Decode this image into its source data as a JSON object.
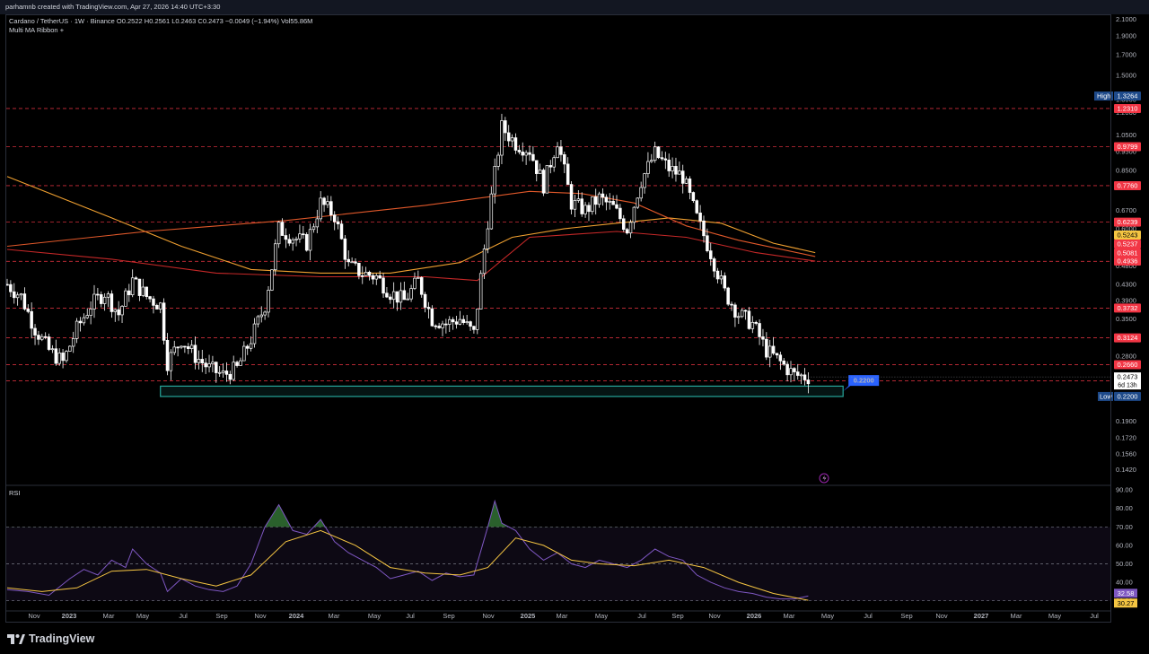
{
  "header": {
    "credit": "parhamnb created with TradingView.com, Apr 27, 2026 14:40 UTC+3:30",
    "symbol_line": "Cardano / TetherUS · 1W · Binance  O0.2522  H0.2561  L0.2463  C0.2473  −0.0049 (−1.94%)  Vol55.86M",
    "indicator": "Multi MA Ribbon +"
  },
  "rsi_panel": {
    "label": "RSI"
  },
  "branding": {
    "name": "TradingView"
  },
  "colors": {
    "background": "#000000",
    "up_candle": "#ffffff",
    "down_candle": "#ffffff",
    "resistance_line": "#f23645",
    "support_zone": "#26a69a",
    "ma_orange": "#f0a030",
    "ma_red": "#c62828",
    "rsi_line": "#7e57c2",
    "rsi_ma": "#f5c542",
    "low_tag": "#1e4a8a",
    "callout": "#2962ff"
  },
  "chart_data": [
    {
      "type": "candlestick",
      "title": "Cardano / TetherUS · 1W · Binance",
      "y_scale": "log",
      "ylim": [
        0.13,
        2.15
      ],
      "price_ticks": [
        "2.1000",
        "1.9000",
        "1.7000",
        "1.5000",
        "1.3000",
        "1.2000",
        "1.0500",
        "0.9500",
        "0.8500",
        "0.7700",
        "0.6700",
        "0.6000",
        "0.5200",
        "0.4800",
        "0.4300",
        "0.3900",
        "0.3500",
        "0.3100",
        "0.2800",
        "0.2500",
        "0.2200",
        "0.1900",
        "0.1720",
        "0.1560",
        "0.1420"
      ],
      "x_ticks": [
        "Nov",
        "2023",
        "Mar",
        "May",
        "Jul",
        "Sep",
        "Nov",
        "2024",
        "Mar",
        "May",
        "Jul",
        "Sep",
        "Nov",
        "2025",
        "Mar",
        "May",
        "Jul",
        "Sep",
        "Nov",
        "2026",
        "Mar",
        "May",
        "Jul",
        "Sep",
        "Nov",
        "2027",
        "Mar",
        "May",
        "Jul"
      ],
      "x_range_weeks": [
        0,
        253
      ],
      "ohlc": {
        "open": "0.2522",
        "high": "0.2561",
        "low": "0.2463",
        "close": "0.2473",
        "change": "−0.0049",
        "change_pct": "−1.94%",
        "volume": "55.86M"
      },
      "period_high": {
        "label": "High",
        "value": "1.3264"
      },
      "period_low": {
        "label": "Low",
        "value": "0.2200"
      },
      "horizontal_levels": [
        1.231,
        0.9799,
        0.776,
        0.6239,
        0.4936,
        0.3732,
        0.3124,
        0.266,
        0.2415
      ],
      "price_tags": [
        {
          "value": "1.2310",
          "color": "#f23645"
        },
        {
          "value": "0.9799",
          "color": "#f23645"
        },
        {
          "value": "0.7760",
          "color": "#f23645"
        },
        {
          "value": "0.6239",
          "color": "#f23645"
        },
        {
          "value": "0.5243",
          "color": "#f5c542"
        },
        {
          "value": "0.5237",
          "color": "#f23645"
        },
        {
          "value": "0.5081",
          "color": "#f23645"
        },
        {
          "value": "0.4936",
          "color": "#f23645"
        },
        {
          "value": "0.3732",
          "color": "#f23645"
        },
        {
          "value": "0.3124",
          "color": "#f23645"
        },
        {
          "value": "0.2660",
          "color": "#f23645"
        },
        {
          "value": "0.2415",
          "color": "#f23645"
        }
      ],
      "last_price": {
        "value": "0.2473",
        "countdown": "6d 13h"
      },
      "support_zone": {
        "from": 0.22,
        "to": 0.234,
        "label": "0.2200"
      },
      "moving_averages": [
        {
          "color": "#f0a030",
          "points": [
            [
              0,
              0.82
            ],
            [
              30,
              0.64
            ],
            [
              50,
              0.54
            ],
            [
              70,
              0.47
            ],
            [
              90,
              0.46
            ],
            [
              110,
              0.46
            ],
            [
              130,
              0.49
            ],
            [
              145,
              0.57
            ],
            [
              160,
              0.6
            ],
            [
              175,
              0.62
            ],
            [
              190,
              0.64
            ],
            [
              205,
              0.62
            ],
            [
              220,
              0.55
            ],
            [
              232,
              0.52
            ]
          ]
        },
        {
          "color": "#e0582a",
          "points": [
            [
              0,
              0.54
            ],
            [
              40,
              0.59
            ],
            [
              80,
              0.63
            ],
            [
              120,
              0.69
            ],
            [
              150,
              0.75
            ],
            [
              165,
              0.74
            ],
            [
              180,
              0.7
            ],
            [
              195,
              0.61
            ],
            [
              210,
              0.56
            ],
            [
              232,
              0.508
            ]
          ]
        },
        {
          "color": "#c62828",
          "points": [
            [
              0,
              0.53
            ],
            [
              30,
              0.5
            ],
            [
              60,
              0.46
            ],
            [
              90,
              0.45
            ],
            [
              120,
              0.45
            ],
            [
              135,
              0.44
            ],
            [
              150,
              0.57
            ],
            [
              175,
              0.59
            ],
            [
              195,
              0.57
            ],
            [
              215,
              0.52
            ],
            [
              232,
              0.494
            ]
          ]
        }
      ],
      "close_path": [
        [
          0,
          0.43
        ],
        [
          4,
          0.4
        ],
        [
          8,
          0.33
        ],
        [
          12,
          0.29
        ],
        [
          16,
          0.27
        ],
        [
          20,
          0.33
        ],
        [
          24,
          0.38
        ],
        [
          28,
          0.41
        ],
        [
          32,
          0.36
        ],
        [
          36,
          0.44
        ],
        [
          40,
          0.4
        ],
        [
          44,
          0.38
        ],
        [
          46,
          0.27
        ],
        [
          50,
          0.31
        ],
        [
          54,
          0.28
        ],
        [
          58,
          0.26
        ],
        [
          62,
          0.25
        ],
        [
          66,
          0.26
        ],
        [
          70,
          0.31
        ],
        [
          74,
          0.38
        ],
        [
          78,
          0.6
        ],
        [
          82,
          0.57
        ],
        [
          86,
          0.55
        ],
        [
          90,
          0.7
        ],
        [
          94,
          0.65
        ],
        [
          98,
          0.48
        ],
        [
          102,
          0.46
        ],
        [
          106,
          0.45
        ],
        [
          110,
          0.41
        ],
        [
          114,
          0.39
        ],
        [
          118,
          0.44
        ],
        [
          122,
          0.35
        ],
        [
          126,
          0.34
        ],
        [
          130,
          0.35
        ],
        [
          134,
          0.32
        ],
        [
          138,
          0.63
        ],
        [
          142,
          1.1
        ],
        [
          146,
          1.0
        ],
        [
          150,
          0.96
        ],
        [
          154,
          0.78
        ],
        [
          158,
          1.02
        ],
        [
          162,
          0.7
        ],
        [
          166,
          0.67
        ],
        [
          170,
          0.72
        ],
        [
          174,
          0.68
        ],
        [
          178,
          0.6
        ],
        [
          182,
          0.8
        ],
        [
          186,
          0.94
        ],
        [
          190,
          0.86
        ],
        [
          194,
          0.82
        ],
        [
          198,
          0.64
        ],
        [
          202,
          0.52
        ],
        [
          206,
          0.41
        ],
        [
          210,
          0.36
        ],
        [
          214,
          0.34
        ],
        [
          218,
          0.29
        ],
        [
          222,
          0.27
        ],
        [
          226,
          0.25
        ],
        [
          230,
          0.2473
        ]
      ]
    },
    {
      "type": "line",
      "title": "RSI",
      "ylim": [
        25,
        92
      ],
      "y_ticks": [
        "90.00",
        "80.00",
        "70.00",
        "60.00",
        "50.00",
        "40.00",
        "30.00"
      ],
      "band": [
        30,
        70
      ],
      "rsi_value": "32.58",
      "rsi_ma_value": "30.27",
      "series": [
        {
          "points": [
            [
              0,
              36
            ],
            [
              6,
              35
            ],
            [
              12,
              33
            ],
            [
              18,
              42
            ],
            [
              22,
              47
            ],
            [
              26,
              44
            ],
            [
              30,
              52
            ],
            [
              34,
              48
            ],
            [
              36,
              58
            ],
            [
              40,
              50
            ],
            [
              44,
              45
            ],
            [
              46,
              35
            ],
            [
              50,
              42
            ],
            [
              54,
              38
            ],
            [
              58,
              36
            ],
            [
              62,
              35
            ],
            [
              66,
              38
            ],
            [
              70,
              50
            ],
            [
              74,
              70
            ],
            [
              78,
              82
            ],
            [
              82,
              68
            ],
            [
              86,
              66
            ],
            [
              90,
              74
            ],
            [
              94,
              62
            ],
            [
              98,
              56
            ],
            [
              102,
              52
            ],
            [
              106,
              48
            ],
            [
              110,
              42
            ],
            [
              114,
              44
            ],
            [
              118,
              46
            ],
            [
              122,
              41
            ],
            [
              126,
              45
            ],
            [
              130,
              43
            ],
            [
              134,
              44
            ],
            [
              138,
              70
            ],
            [
              140,
              84
            ],
            [
              142,
              72
            ],
            [
              146,
              68
            ],
            [
              150,
              58
            ],
            [
              154,
              52
            ],
            [
              158,
              56
            ],
            [
              162,
              50
            ],
            [
              166,
              48
            ],
            [
              170,
              52
            ],
            [
              174,
              50
            ],
            [
              178,
              48
            ],
            [
              182,
              52
            ],
            [
              186,
              58
            ],
            [
              190,
              54
            ],
            [
              194,
              52
            ],
            [
              198,
              44
            ],
            [
              202,
              40
            ],
            [
              206,
              37
            ],
            [
              210,
              35
            ],
            [
              214,
              34
            ],
            [
              218,
              32
            ],
            [
              222,
              31
            ],
            [
              226,
              31
            ],
            [
              230,
              32.58
            ]
          ]
        },
        {
          "points": [
            [
              0,
              37
            ],
            [
              10,
              35
            ],
            [
              20,
              37
            ],
            [
              30,
              46
            ],
            [
              40,
              47
            ],
            [
              50,
              42
            ],
            [
              60,
              38
            ],
            [
              70,
              44
            ],
            [
              80,
              62
            ],
            [
              90,
              68
            ],
            [
              100,
              60
            ],
            [
              110,
              48
            ],
            [
              120,
              45
            ],
            [
              130,
              44
            ],
            [
              138,
              48
            ],
            [
              146,
              64
            ],
            [
              154,
              60
            ],
            [
              162,
              52
            ],
            [
              170,
              50
            ],
            [
              180,
              49
            ],
            [
              190,
              52
            ],
            [
              200,
              48
            ],
            [
              210,
              40
            ],
            [
              220,
              34
            ],
            [
              230,
              30.27
            ]
          ]
        }
      ]
    }
  ]
}
